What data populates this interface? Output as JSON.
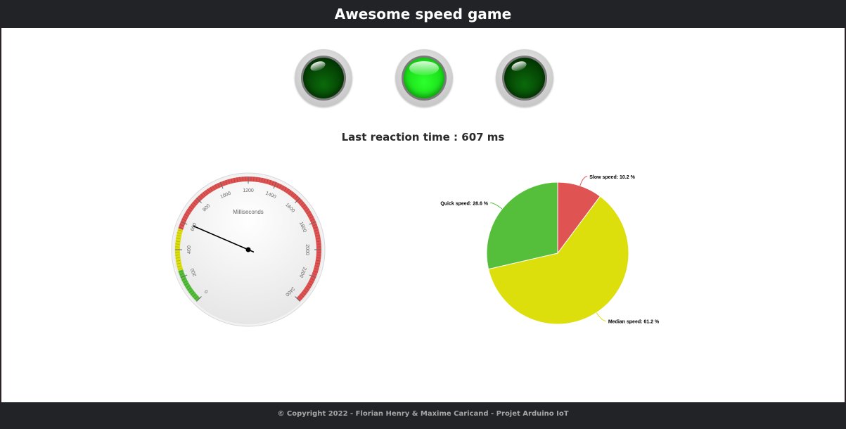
{
  "header": {
    "title": "Awesome speed game"
  },
  "leds": [
    {
      "name": "led-left",
      "state": "off"
    },
    {
      "name": "led-middle",
      "state": "on"
    },
    {
      "name": "led-right",
      "state": "off"
    }
  ],
  "reaction": {
    "text": "Last reaction time : 607 ms"
  },
  "gauge": {
    "title": "Milliseconds",
    "value": 607,
    "min": 0,
    "max": 2400,
    "ticks": [
      "0",
      "200",
      "400",
      "600",
      "800",
      "1000",
      "1200",
      "1400",
      "1600",
      "1800",
      "2000",
      "2200",
      "2400"
    ],
    "bands": [
      {
        "from": 0,
        "to": 250,
        "color": "#55bf3b"
      },
      {
        "from": 250,
        "to": 550,
        "color": "#dddf0d"
      },
      {
        "from": 550,
        "to": 2400,
        "color": "#df5353"
      }
    ]
  },
  "chart_data": {
    "type": "pie",
    "slices": [
      {
        "label": "Slow speed: 10.2 %",
        "value": 10.2,
        "color": "#df5353"
      },
      {
        "label": "Median speed: 61.2 %",
        "value": 61.2,
        "color": "#dddf0d"
      },
      {
        "label": "Quick speed: 28.6 %",
        "value": 28.6,
        "color": "#55bf3b"
      }
    ]
  },
  "footer": {
    "text": "© Copyright 2022 - Florian Henry & Maxime Caricand - Projet Arduino IoT"
  }
}
